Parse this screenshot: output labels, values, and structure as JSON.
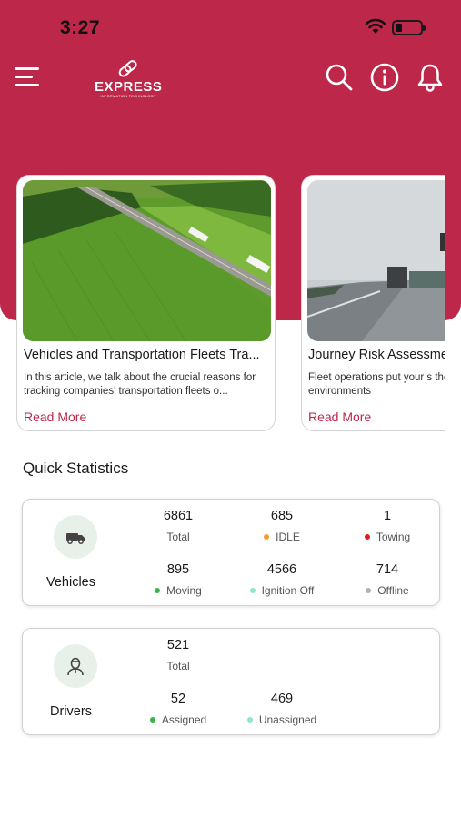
{
  "status": {
    "time": "3:27"
  },
  "header": {
    "logo_text": "EXPRESS",
    "logo_sub": "INFORMATION TECHNOLOGY"
  },
  "articles": [
    {
      "title": "Vehicles and Transportation Fleets Tra...",
      "description": "In this article, we talk about the crucial reasons for tracking companies' transportation fleets o...",
      "read_more": "Read More"
    },
    {
      "title": "Journey Risk Assessme",
      "description": "Fleet operations put your s the dynamic environments",
      "read_more": "Read More"
    }
  ],
  "quick_stats": {
    "title": "Quick Statistics",
    "vehicles": {
      "label": "Vehicles",
      "items": [
        {
          "value": "6861",
          "caption": "Total",
          "dot": ""
        },
        {
          "value": "685",
          "caption": "IDLE",
          "dot": "#f0a030"
        },
        {
          "value": "1",
          "caption": "Towing",
          "dot": "#d62020"
        },
        {
          "value": "895",
          "caption": "Moving",
          "dot": "#3cb44b"
        },
        {
          "value": "4566",
          "caption": "Ignition Off",
          "dot": "#8ee8c8"
        },
        {
          "value": "714",
          "caption": "Offline",
          "dot": "#b0b0b0"
        }
      ]
    },
    "drivers": {
      "label": "Drivers",
      "items": [
        {
          "value": "521",
          "caption": "Total",
          "dot": ""
        },
        {
          "value": "52",
          "caption": "Assigned",
          "dot": "#3cb44b"
        },
        {
          "value": "469",
          "caption": "Unassigned",
          "dot": "#8ee8c8"
        }
      ]
    }
  },
  "colors": {
    "brand": "#bd2749",
    "icon_bg": "#e7f1ea"
  }
}
